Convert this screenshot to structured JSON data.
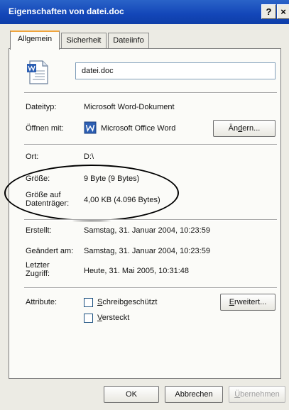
{
  "window": {
    "title": "Eigenschaften von datei.doc",
    "help_glyph": "?",
    "close_glyph": "×"
  },
  "tabs": [
    {
      "label": "Allgemein",
      "active": true
    },
    {
      "label": "Sicherheit",
      "active": false
    },
    {
      "label": "Dateiinfo",
      "active": false
    }
  ],
  "file": {
    "name": "datei.doc",
    "icon": "word-document-icon"
  },
  "details": {
    "dateityp_label": "Dateityp:",
    "dateityp_value": "Microsoft Word-Dokument",
    "oeffnen_label": "Öffnen mit:",
    "oeffnen_value": "Microsoft Office Word",
    "app_icon": "word-app-icon",
    "aendern_button_pre": "Än",
    "aendern_button_u": "d",
    "aendern_button_post": "ern...",
    "ort_label": "Ort:",
    "ort_value": "D:\\",
    "groesse_label": "Größe:",
    "groesse_value": "9 Byte (9 Bytes)",
    "groesse_auf_label_1": "Größe auf",
    "groesse_auf_label_2": "Datenträger:",
    "groesse_auf_value": "4,00 KB (4.096 Bytes)",
    "erstellt_label": "Erstellt:",
    "erstellt_value": "Samstag, 31. Januar 2004, 10:23:59",
    "geaendert_label": "Geändert am:",
    "geaendert_value": "Samstag, 31. Januar 2004, 10:23:59",
    "letzter_label_1": "Letzter",
    "letzter_label_2": "Zugriff:",
    "letzter_value": "Heute, 31. Mai 2005, 10:31:48",
    "attribute_label": "Attribute:",
    "schreib_u": "S",
    "schreib_rest": "chreibgeschützt",
    "schreib_checked": false,
    "versteckt_u": "V",
    "versteckt_rest": "ersteckt",
    "versteckt_checked": false,
    "erweitert_u": "E",
    "erweitert_rest": "rweitert..."
  },
  "footer": {
    "ok": "OK",
    "abbrechen": "Abbrechen",
    "uebernehmen_u": "Ü",
    "uebernehmen_rest": "bernehmen"
  }
}
